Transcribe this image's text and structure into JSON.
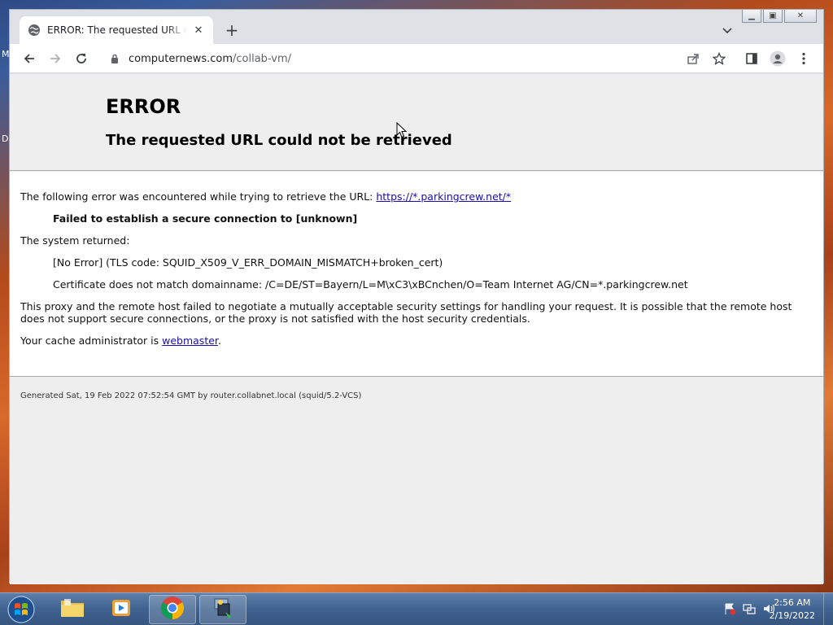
{
  "desktop": {
    "edge_letters": [
      "M",
      "D"
    ]
  },
  "browser": {
    "tab": {
      "title": "ERROR: The requested URL could not be retrieved"
    },
    "address": {
      "host": "computernews.com",
      "path": "/collab-vm/"
    }
  },
  "page": {
    "heading": "ERROR",
    "subheading": "The requested URL could not be retrieved",
    "intro_text": "The following error was encountered while trying to retrieve the URL: ",
    "intro_link": "https://*.parkingcrew.net/*",
    "error_message": "Failed to establish a secure connection to [unknown]",
    "system_returned_label": "The system returned:",
    "system_error": "[No Error] (TLS code: SQUID_X509_V_ERR_DOMAIN_MISMATCH+broken_cert)",
    "cert_detail": "Certificate does not match domainname: /C=DE/ST=Bayern/L=M\\xC3\\xBCnchen/O=Team Internet AG/CN=*.parkingcrew.net",
    "explanation": "This proxy and the remote host failed to negotiate a mutually acceptable security settings for handling your request. It is possible that the remote host does not support secure connections, or the proxy is not satisfied with the host security credentials.",
    "admin_text": "Your cache administrator is ",
    "admin_link": "webmaster",
    "admin_suffix": ".",
    "footer": "Generated Sat, 19 Feb 2022 07:52:54 GMT by router.collabnet.local (squid/5.2-VCS)"
  },
  "taskbar": {
    "items": [
      "explorer",
      "media-player",
      "chrome",
      "network-tool"
    ],
    "clock": {
      "time": "2:56 AM",
      "date": "2/19/2022"
    }
  },
  "colors": {
    "link": "#1a0dab",
    "taskbar": "#3f6290",
    "page_bg": "#eeeeee"
  }
}
